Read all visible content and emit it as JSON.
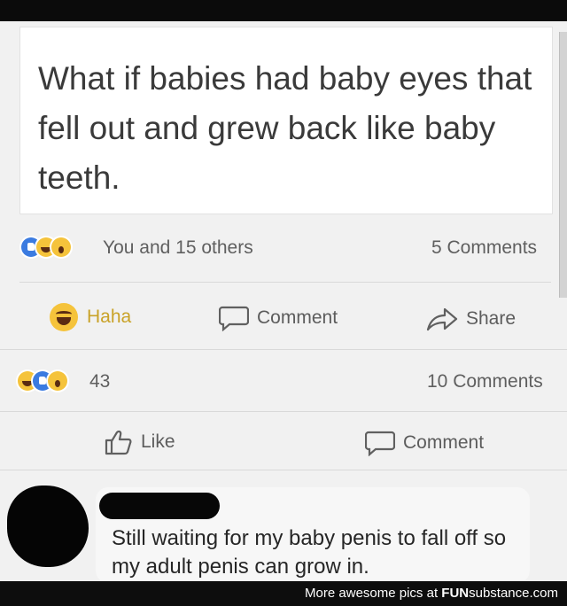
{
  "post": {
    "text": "What if babies had baby eyes that fell out and grew back like baby teeth."
  },
  "post_stats": {
    "reactions_text": "You and 15 others",
    "comments_text": "5 Comments",
    "reaction_icons": [
      "like-icon",
      "haha-icon",
      "wow-icon"
    ]
  },
  "post_actions": {
    "haha_label": "Haha",
    "comment_label": "Comment",
    "share_label": "Share"
  },
  "second_stats": {
    "reaction_count": "43",
    "comments_text": "10 Comments",
    "reaction_icons": [
      "haha-icon",
      "like-icon",
      "wow-icon"
    ]
  },
  "second_actions": {
    "like_label": "Like",
    "comment_label": "Comment"
  },
  "comment": {
    "text": "Still waiting for my baby penis to fall off so my adult penis can grow in."
  },
  "footer": {
    "prefix": "More awesome pics at",
    "brand_bold": "FUN",
    "brand_rest": "substance.com"
  },
  "colors": {
    "haha_active": "#c9a227",
    "like_blue": "#3b7be0",
    "emoji_yellow": "#f5c33b"
  }
}
